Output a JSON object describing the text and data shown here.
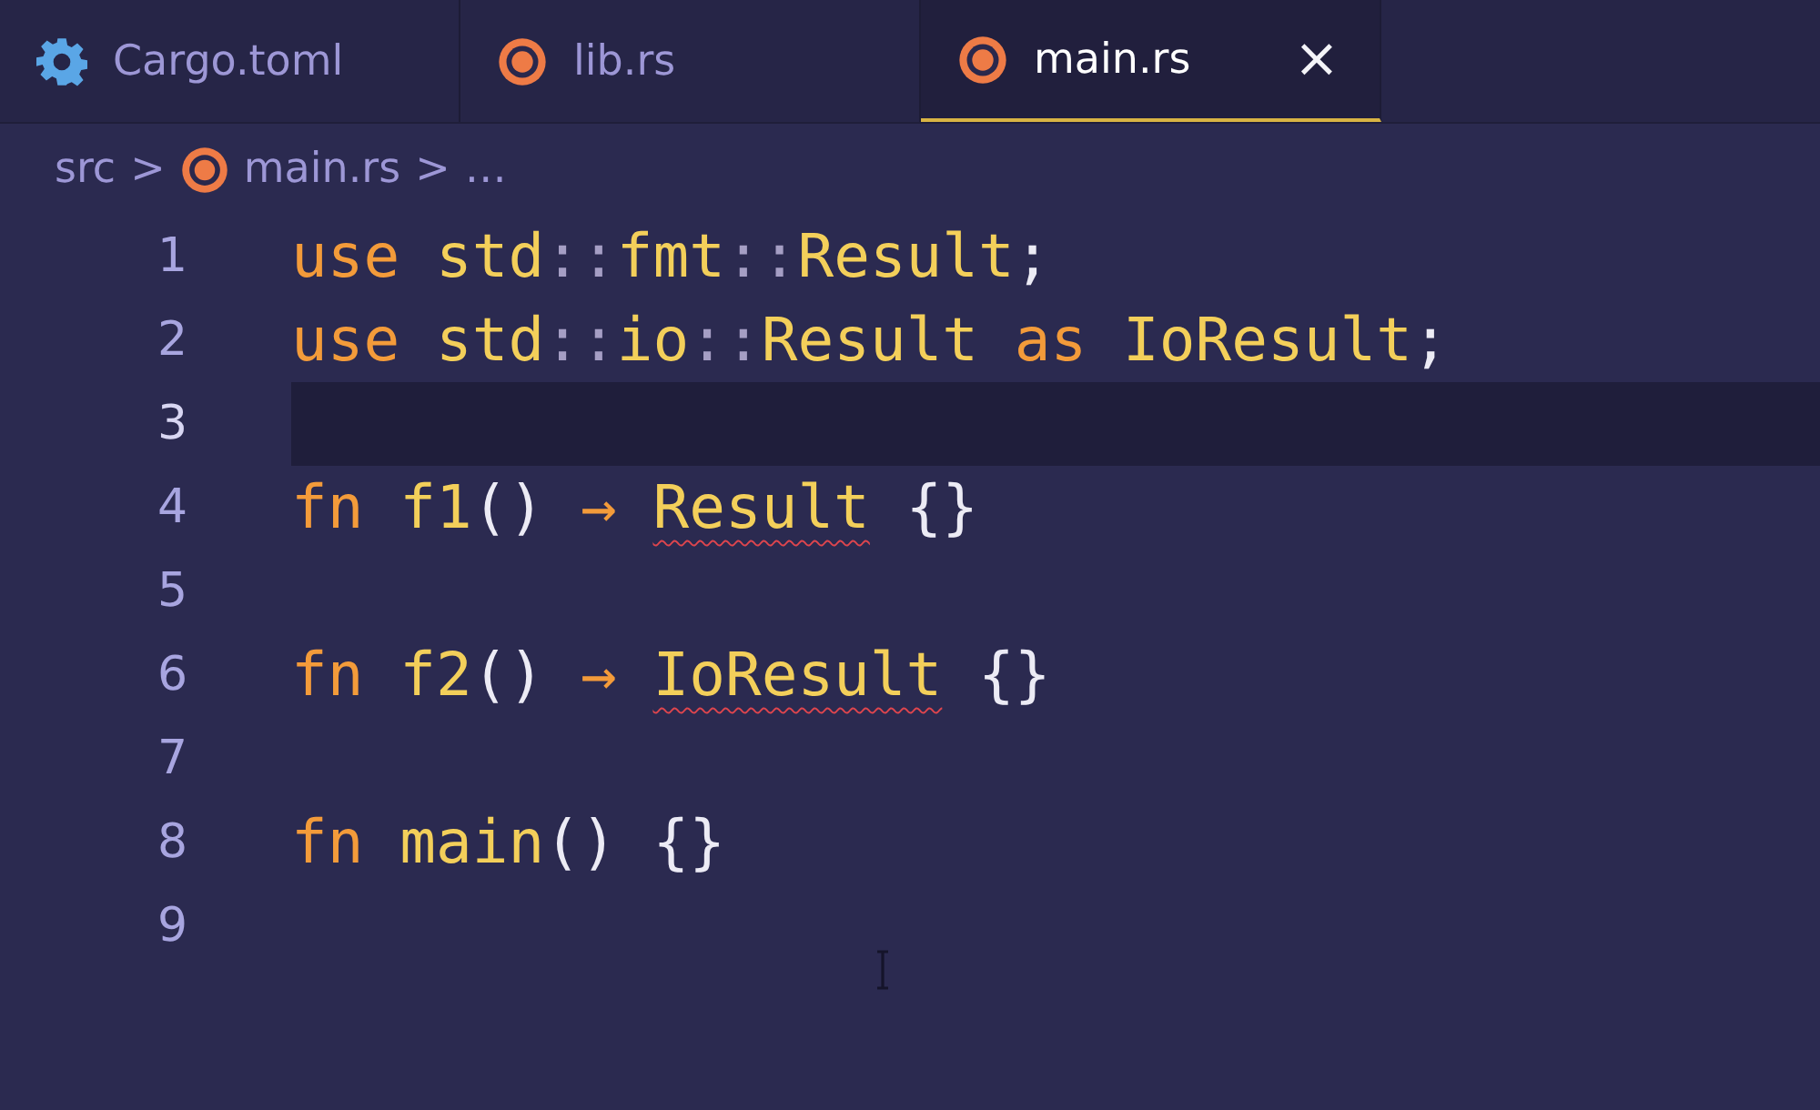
{
  "tabs": [
    {
      "label": "Cargo.toml",
      "kind": "config",
      "selected": false
    },
    {
      "label": "lib.rs",
      "kind": "rust",
      "selected": false
    },
    {
      "label": "main.rs",
      "kind": "rust",
      "selected": true,
      "close": "×"
    }
  ],
  "breadcrumb": [
    {
      "label": "src",
      "kind": "folder"
    },
    {
      "label": "main.rs",
      "kind": "rust"
    },
    {
      "label": "…",
      "kind": "more"
    }
  ],
  "breadcrumb_separator": ">",
  "editor": {
    "lines": [
      {
        "number": "1",
        "current": false,
        "tokens": [
          {
            "text": "use",
            "kind": "keyword"
          },
          {
            "text": " std",
            "kind": "ident"
          },
          {
            "text": "::",
            "kind": "path"
          },
          {
            "text": "fmt",
            "kind": "ident"
          },
          {
            "text": "::",
            "kind": "path"
          },
          {
            "text": "Result",
            "kind": "ident"
          },
          {
            "text": ";",
            "kind": "punct"
          }
        ]
      },
      {
        "number": "2",
        "current": false,
        "tokens": [
          {
            "text": "use",
            "kind": "keyword"
          },
          {
            "text": " std",
            "kind": "ident"
          },
          {
            "text": "::",
            "kind": "path"
          },
          {
            "text": "io",
            "kind": "ident"
          },
          {
            "text": "::",
            "kind": "path"
          },
          {
            "text": "Result ",
            "kind": "ident"
          },
          {
            "text": "as ",
            "kind": "keyword"
          },
          {
            "text": "IoResult",
            "kind": "ident"
          },
          {
            "text": ";",
            "kind": "punct"
          }
        ]
      },
      {
        "number": "3",
        "current": true
      },
      {
        "number": "4",
        "current": false,
        "tokens": [
          {
            "text": "fn ",
            "kind": "keyword"
          },
          {
            "text": "f1",
            "kind": "ident"
          },
          {
            "text": "() ",
            "kind": "punct"
          },
          {
            "text": "→ ",
            "kind": "keyword"
          },
          {
            "text": "Result",
            "kind": "ident",
            "error": true
          },
          {
            "text": " {}",
            "kind": "punct"
          }
        ]
      },
      {
        "number": "5",
        "current": false
      },
      {
        "number": "6",
        "current": false,
        "tokens": [
          {
            "text": "fn ",
            "kind": "keyword"
          },
          {
            "text": "f2",
            "kind": "ident"
          },
          {
            "text": "() ",
            "kind": "punct"
          },
          {
            "text": "→ ",
            "kind": "keyword"
          },
          {
            "text": "IoResult",
            "kind": "ident",
            "error": true
          },
          {
            "text": " {}",
            "kind": "punct"
          }
        ]
      },
      {
        "number": "7",
        "current": false
      },
      {
        "number": "8",
        "current": false,
        "tokens": [
          {
            "text": "fn ",
            "kind": "keyword"
          },
          {
            "text": "main",
            "kind": "ident"
          },
          {
            "text": "() {}",
            "kind": "punct"
          }
        ]
      },
      {
        "number": "9",
        "current": false
      }
    ]
  }
}
